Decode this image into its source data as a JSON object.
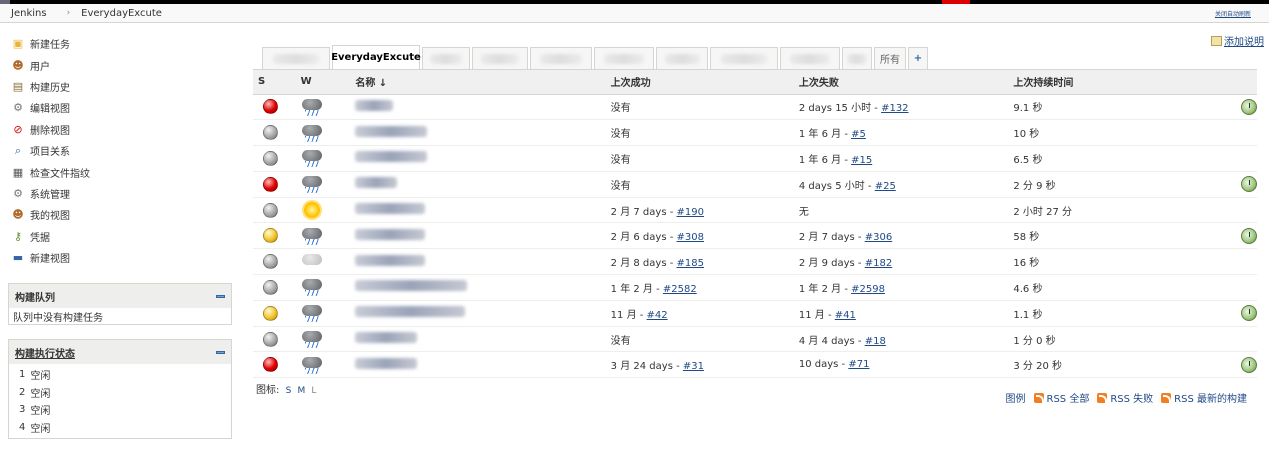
{
  "breadcrumb": {
    "root": "Jenkins",
    "current": "EverydayExcute",
    "right_link": "关闭自动刷新"
  },
  "sidebar": {
    "items": [
      {
        "label": "新建任务",
        "icon": "new-job-icon"
      },
      {
        "label": "用户",
        "icon": "users-icon"
      },
      {
        "label": "构建历史",
        "icon": "history-icon"
      },
      {
        "label": "编辑视图",
        "icon": "gear-icon"
      },
      {
        "label": "删除视图",
        "icon": "no-entry-icon"
      },
      {
        "label": "项目关系",
        "icon": "search-icon"
      },
      {
        "label": "检查文件指纹",
        "icon": "fingerprint-icon"
      },
      {
        "label": "系统管理",
        "icon": "gear-icon"
      },
      {
        "label": "我的视图",
        "icon": "user-icon"
      },
      {
        "label": "凭据",
        "icon": "credentials-icon"
      },
      {
        "label": "新建视图",
        "icon": "folder-icon"
      }
    ]
  },
  "build_queue": {
    "title": "构建队列",
    "empty_text": "队列中没有构建任务"
  },
  "executors": {
    "title": "构建执行状态",
    "rows": [
      {
        "num": "1",
        "status": "空闲"
      },
      {
        "num": "2",
        "status": "空闲"
      },
      {
        "num": "3",
        "status": "空闲"
      },
      {
        "num": "4",
        "status": "空闲"
      }
    ]
  },
  "tabs": {
    "active": "EverydayExcute",
    "all": "所有",
    "plus": "+"
  },
  "add_description": "添加说明",
  "table": {
    "headers": {
      "s": "S",
      "w": "W",
      "name": "名称 ↓",
      "last_success": "上次成功",
      "last_failure": "上次失败",
      "last_duration": "上次持续时间"
    },
    "rows": [
      {
        "status": "red",
        "weather": "rain",
        "ok": "没有",
        "ok_build": "",
        "fail": "2 days 15 小时 - ",
        "fail_build": "#132",
        "dur": "9.1 秒",
        "sched": true
      },
      {
        "status": "grey",
        "weather": "rain",
        "ok": "没有",
        "ok_build": "",
        "fail": "1 年 6 月 - ",
        "fail_build": "#5",
        "dur": "10 秒",
        "sched": false
      },
      {
        "status": "grey",
        "weather": "rain",
        "ok": "没有",
        "ok_build": "",
        "fail": "1 年 6 月 - ",
        "fail_build": "#15",
        "dur": "6.5 秒",
        "sched": false
      },
      {
        "status": "red",
        "weather": "rain",
        "ok": "没有",
        "ok_build": "",
        "fail": "4 days 5 小时 - ",
        "fail_build": "#25",
        "dur": "2 分 9 秒",
        "sched": true
      },
      {
        "status": "grey",
        "weather": "sun",
        "ok": "2 月 7 days - ",
        "ok_build": "#190",
        "fail": "无",
        "fail_build": "",
        "dur": "2 小时 27 分",
        "sched": false
      },
      {
        "status": "yellow",
        "weather": "rain",
        "ok": "2 月 6 days - ",
        "ok_build": "#308",
        "fail": "2 月 7 days - ",
        "fail_build": "#306",
        "dur": "58 秒",
        "sched": true
      },
      {
        "status": "grey",
        "weather": "cloudy",
        "ok": "2 月 8 days - ",
        "ok_build": "#185",
        "fail": "2 月 9 days - ",
        "fail_build": "#182",
        "dur": "16 秒",
        "sched": false
      },
      {
        "status": "grey",
        "weather": "rain",
        "ok": "1 年 2 月 - ",
        "ok_build": "#2582",
        "fail": "1 年 2 月 - ",
        "fail_build": "#2598",
        "dur": "4.6 秒",
        "sched": false
      },
      {
        "status": "yellow",
        "weather": "rain",
        "ok": "11 月 - ",
        "ok_build": "#42",
        "fail": "11 月 - ",
        "fail_build": "#41",
        "dur": "1.1 秒",
        "sched": true
      },
      {
        "status": "grey",
        "weather": "rain",
        "ok": "没有",
        "ok_build": "",
        "fail": "4 月 4 days - ",
        "fail_build": "#18",
        "dur": "1 分 0 秒",
        "sched": false
      },
      {
        "status": "red",
        "weather": "rain",
        "ok": "3 月 24 days - ",
        "ok_build": "#31",
        "fail": "10 days - ",
        "fail_build": "#71",
        "dur": "3 分 20 秒",
        "sched": true
      }
    ]
  },
  "icon_size": {
    "label": "图标:",
    "s": "S",
    "m": "M",
    "l": "L"
  },
  "footer_links": {
    "legend": "图例",
    "rss_all": "RSS 全部",
    "rss_fail": "RSS 失败",
    "rss_latest": "RSS 最新的构建"
  }
}
